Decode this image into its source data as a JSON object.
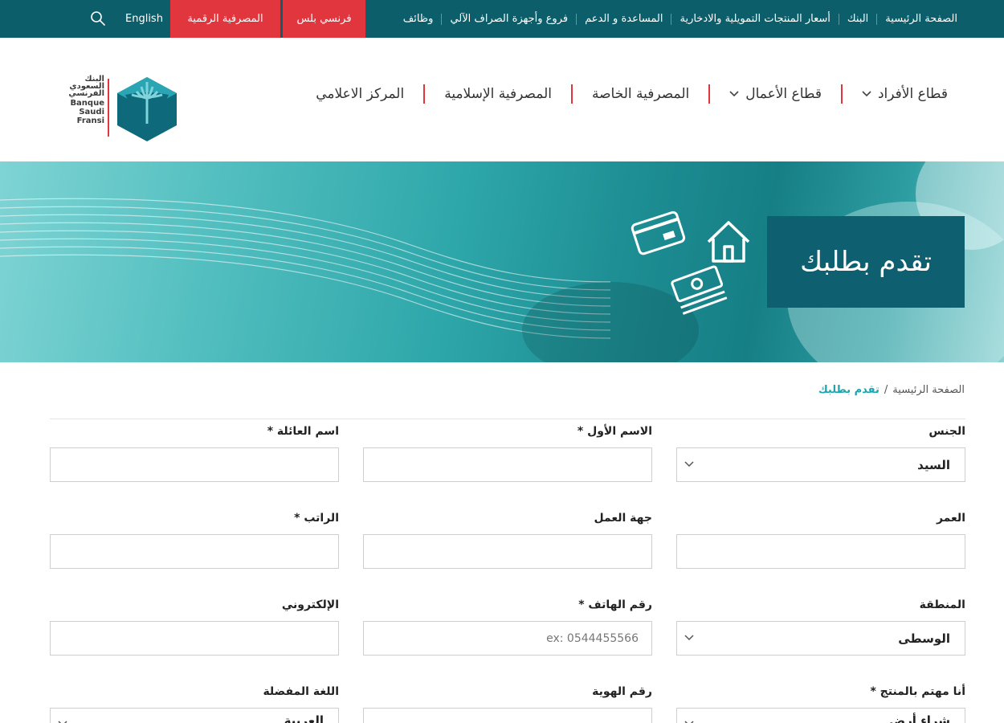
{
  "topbar": {
    "nav": [
      "الصفحة الرئيسية",
      "البنك",
      "أسعار المنتجات التمويلية والادخارية",
      "المساعدة و الدعم",
      "فروع وأجهزة الصراف الآلي",
      "وظائف"
    ],
    "fransi_plus": "فرنسي بلس",
    "digital_banking": "المصرفية الرقمية",
    "language": "English"
  },
  "logo": {
    "ar": [
      "البنك",
      "السعودي",
      "الفرنسي"
    ],
    "en": [
      "Banque",
      "Saudi",
      "Fransi"
    ]
  },
  "menu": [
    {
      "label": "قطاع الأفراد",
      "dropdown": true
    },
    {
      "label": "قطاع الأعمال",
      "dropdown": true
    },
    {
      "label": "المصرفية الخاصة",
      "dropdown": false
    },
    {
      "label": "المصرفية الإسلامية",
      "dropdown": false
    },
    {
      "label": "المركز الاعلامي",
      "dropdown": false
    }
  ],
  "hero": {
    "title": "تقدم بطلبك"
  },
  "breadcrumb": {
    "home": "الصفحة الرئيسية",
    "separator": "/",
    "current": "تقدم بطلبك"
  },
  "form": {
    "gender": {
      "label": "الجنس",
      "value": "السيد"
    },
    "first_name": {
      "label": "الاسم الأول *",
      "value": ""
    },
    "last_name": {
      "label": "اسم العائلة *",
      "value": ""
    },
    "age": {
      "label": "العمر",
      "value": ""
    },
    "employer": {
      "label": "جهة العمل",
      "value": ""
    },
    "salary": {
      "label": "الراتب *",
      "value": ""
    },
    "region": {
      "label": "المنطقة",
      "value": "الوسطى"
    },
    "phone": {
      "label": "رقم الهاتف *",
      "placeholder": "ex: 0544455566"
    },
    "email": {
      "label": "الإلكتروني",
      "value": ""
    },
    "product": {
      "label": "أنا مهتم بالمنتج *",
      "value": "شراء أرض"
    },
    "id_number": {
      "label": "رقم الهوية",
      "value": ""
    },
    "language": {
      "label": "اللغة المفضلة",
      "value": "العربية"
    }
  },
  "colors": {
    "topbar": "#0b5e6a",
    "accent_red": "#e2363f",
    "hero_box": "#0e6070",
    "link_teal": "#1aa6b0"
  }
}
